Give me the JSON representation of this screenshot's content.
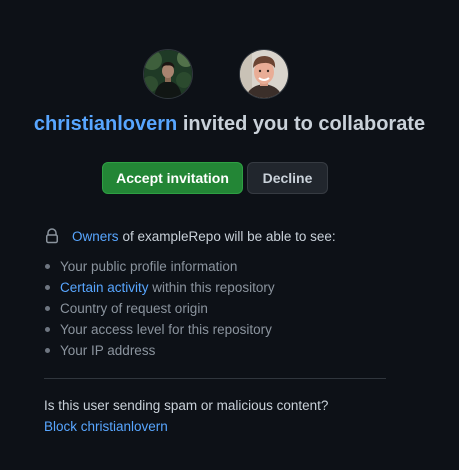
{
  "invitation": {
    "inviter": "christianlovern",
    "headline_rest": " invited you to collaborate"
  },
  "avatars": [
    {
      "icon": "inviter-avatar"
    },
    {
      "icon": "invitee-avatar"
    }
  ],
  "actions": {
    "accept_label": "Accept invitation",
    "decline_label": "Decline"
  },
  "permissions": {
    "icon": "lock-icon",
    "owners_link": "Owners",
    "intro_rest": "of exampleRepo will be able to see:",
    "items": [
      {
        "text": "Your public profile information"
      },
      {
        "link": "Certain activity",
        "text": " within this repository"
      },
      {
        "text": "Country of request origin"
      },
      {
        "text": "Your access level for this repository"
      },
      {
        "text": "Your IP address"
      }
    ]
  },
  "report": {
    "question": "Is this user sending spam or malicious content?",
    "block_label": "Block christianlovern"
  },
  "colors": {
    "background": "#0d1117",
    "link": "#58a6ff",
    "accept_button": "#238636",
    "decline_button": "#21262d",
    "text_primary": "#c9d1d9",
    "text_muted": "#8b949e"
  }
}
